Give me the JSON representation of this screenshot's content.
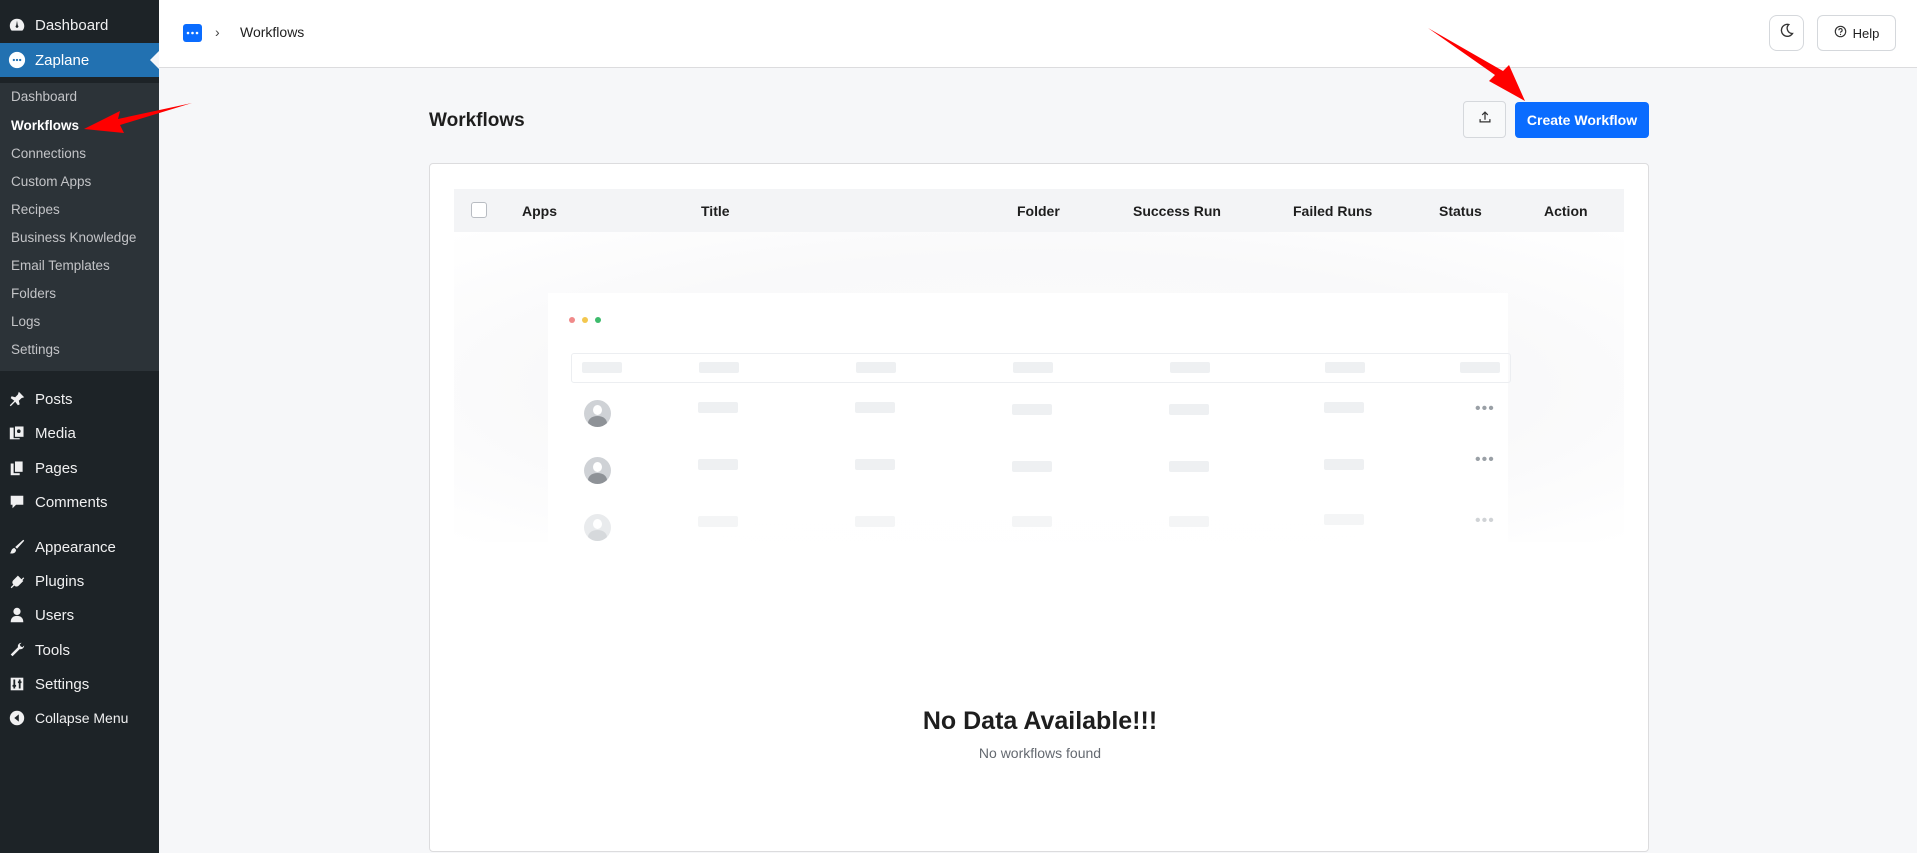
{
  "sidebar": {
    "top_items": [
      {
        "label": "Dashboard",
        "icon": "dashboard-icon"
      },
      {
        "label": "Zaplane",
        "icon": "zaplane-icon"
      }
    ],
    "submenu": [
      {
        "label": "Dashboard"
      },
      {
        "label": "Workflows"
      },
      {
        "label": "Connections"
      },
      {
        "label": "Custom Apps"
      },
      {
        "label": "Recipes"
      },
      {
        "label": "Business Knowledge"
      },
      {
        "label": "Email Templates"
      },
      {
        "label": "Folders"
      },
      {
        "label": "Logs"
      },
      {
        "label": "Settings"
      }
    ],
    "items": [
      {
        "label": "Posts",
        "icon": "pin-icon"
      },
      {
        "label": "Media",
        "icon": "media-icon"
      },
      {
        "label": "Pages",
        "icon": "pages-icon"
      },
      {
        "label": "Comments",
        "icon": "comment-icon"
      },
      {
        "label": "Appearance",
        "icon": "paintbrush-icon"
      },
      {
        "label": "Plugins",
        "icon": "plug-icon"
      },
      {
        "label": "Users",
        "icon": "user-icon"
      },
      {
        "label": "Tools",
        "icon": "wrench-icon"
      },
      {
        "label": "Settings",
        "icon": "settings-icon"
      },
      {
        "label": "Collapse Menu",
        "icon": "collapse-icon"
      }
    ]
  },
  "breadcrumb": {
    "separator": "›",
    "current": "Workflows"
  },
  "header": {
    "help_label": "Help"
  },
  "page": {
    "title": "Workflows",
    "create_label": "Create Workflow"
  },
  "table": {
    "columns": [
      "Apps",
      "Title",
      "Folder",
      "Success Run",
      "Failed Runs",
      "Status",
      "Action"
    ]
  },
  "empty_state": {
    "title": "No Data Available!!!",
    "subtitle": "No workflows found"
  },
  "colors": {
    "accent": "#0a6cff",
    "sidebar_bg": "#1d2327",
    "sidebar_active": "#2271b1",
    "annotation_arrow": "#ff0000"
  }
}
